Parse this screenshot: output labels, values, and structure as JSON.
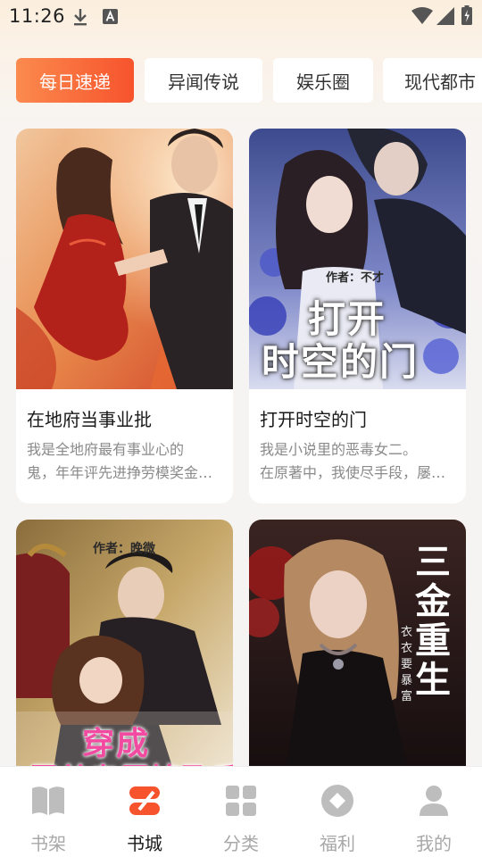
{
  "status_bar": {
    "time": "11:26"
  },
  "tabs": [
    {
      "label": "每日速递",
      "active": true
    },
    {
      "label": "异闻传说",
      "active": false
    },
    {
      "label": "娱乐圈",
      "active": false
    },
    {
      "label": "现代都市",
      "active": false
    }
  ],
  "books": [
    {
      "title": "在地府当事业批",
      "desc_line1": "我是全地府最有事业心的",
      "desc_line2": "鬼，年年评先进挣劳模奖金…",
      "cover_text": ""
    },
    {
      "title": "打开时空的门",
      "desc_line1": "我是小说里的恶毒女二。",
      "desc_line2": "在原著中，我使尽手段，屡…",
      "cover_author": "作者：不才",
      "cover_title_1": "打开",
      "cover_title_2": "时空的门"
    },
    {
      "title": "",
      "cover_author": "作者：晚微",
      "cover_title_1": "穿成",
      "cover_title_2": "霸总专属掉孕后"
    },
    {
      "title": "",
      "cover_title_vertical": "三金重生",
      "cover_author_vertical": "衣衣要暴富"
    }
  ],
  "bottom_nav": [
    {
      "label": "书架",
      "icon": "book-open-icon",
      "active": false
    },
    {
      "label": "书城",
      "icon": "bookstore-icon",
      "active": true
    },
    {
      "label": "分类",
      "icon": "grid-icon",
      "active": false
    },
    {
      "label": "福利",
      "icon": "diamond-icon",
      "active": false
    },
    {
      "label": "我的",
      "icon": "user-icon",
      "active": false
    }
  ],
  "colors": {
    "accent": "#f7532c",
    "accent_light": "#fb8a4e"
  }
}
